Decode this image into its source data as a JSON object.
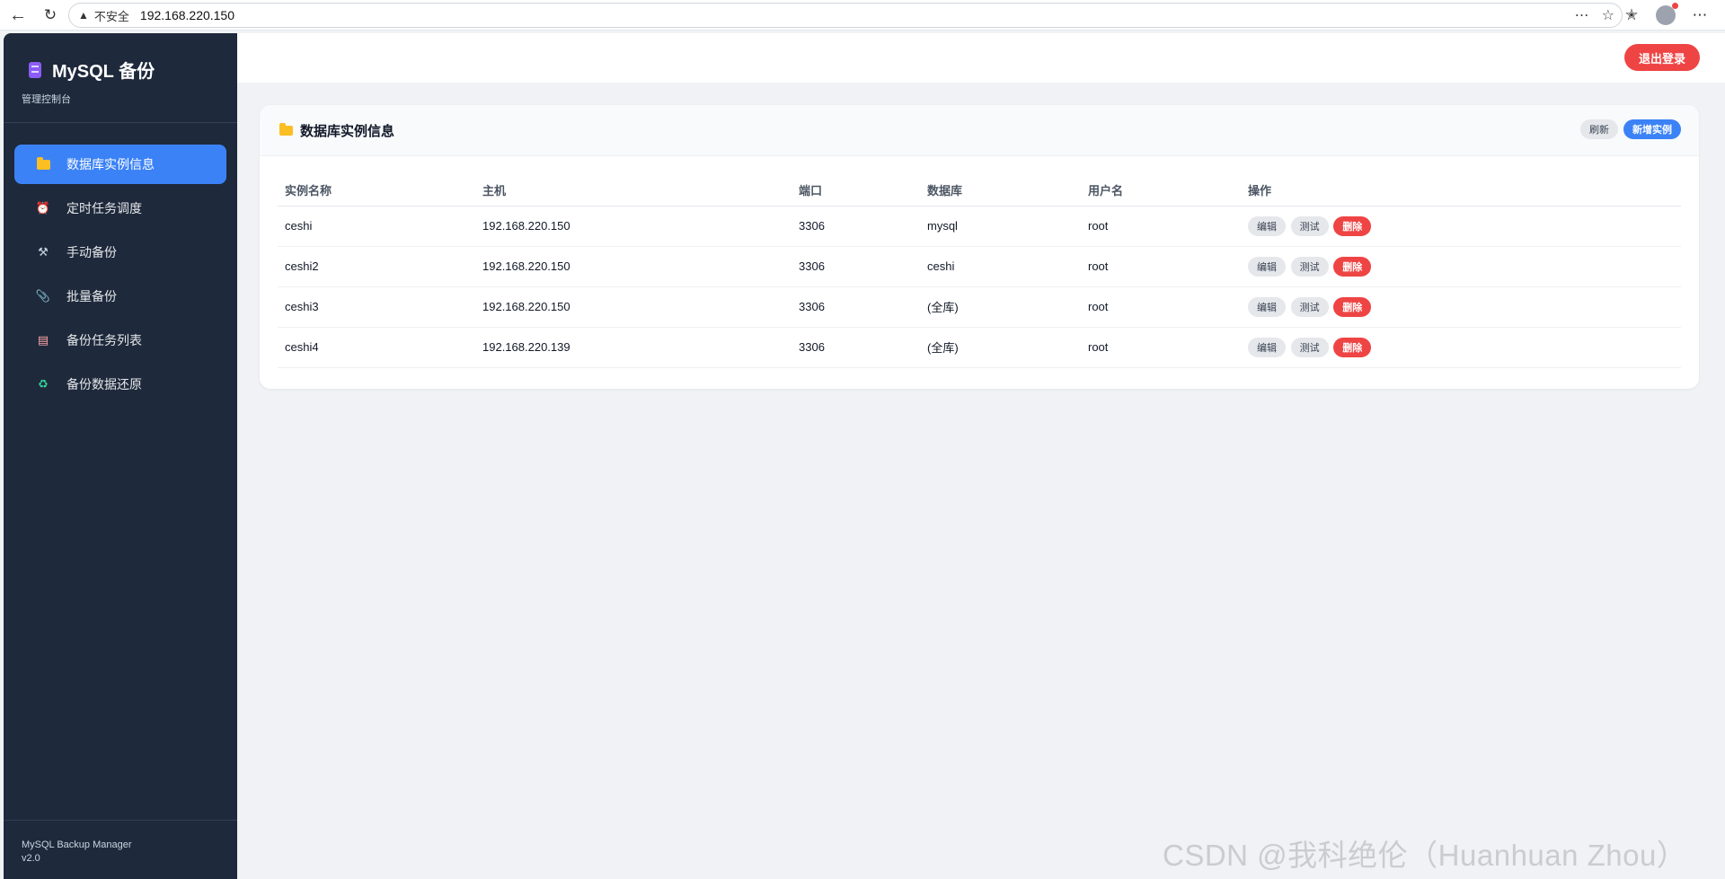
{
  "browser": {
    "security_label": "不安全",
    "url": "192.168.220.150"
  },
  "sidebar": {
    "title": "MySQL 备份",
    "subtitle": "管理控制台",
    "items": [
      {
        "label": "数据库实例信息",
        "icon": "folder-icon",
        "active": true
      },
      {
        "label": "定时任务调度",
        "icon": "alarm-clock-icon"
      },
      {
        "label": "手动备份",
        "icon": "tools-icon"
      },
      {
        "label": "批量备份",
        "icon": "paperclip-icon"
      },
      {
        "label": "备份任务列表",
        "icon": "clipboard-icon"
      },
      {
        "label": "备份数据还原",
        "icon": "recycle-icon"
      }
    ],
    "footer_name": "MySQL Backup Manager",
    "footer_version": "v2.0"
  },
  "topbar": {
    "logout_label": "退出登录"
  },
  "card": {
    "title": "数据库实例信息",
    "refresh_label": "刷新",
    "add_label": "新增实例"
  },
  "table": {
    "headers": [
      "实例名称",
      "主机",
      "端口",
      "数据库",
      "用户名",
      "操作"
    ],
    "rows": [
      [
        "ceshi",
        "192.168.220.150",
        "3306",
        "mysql",
        "root"
      ],
      [
        "ceshi2",
        "192.168.220.150",
        "3306",
        "ceshi",
        "root"
      ],
      [
        "ceshi3",
        "192.168.220.150",
        "3306",
        "(全库)",
        "root"
      ],
      [
        "ceshi4",
        "192.168.220.139",
        "3306",
        "(全库)",
        "root"
      ]
    ],
    "actions": {
      "edit": "编辑",
      "test": "测试",
      "delete": "删除"
    }
  },
  "watermark": "CSDN @我科绝伦（Huanhuan Zhou）",
  "colors": {
    "sidebar_bg": "#1e293b",
    "accent": "#3b82f6",
    "danger": "#ef4444"
  }
}
